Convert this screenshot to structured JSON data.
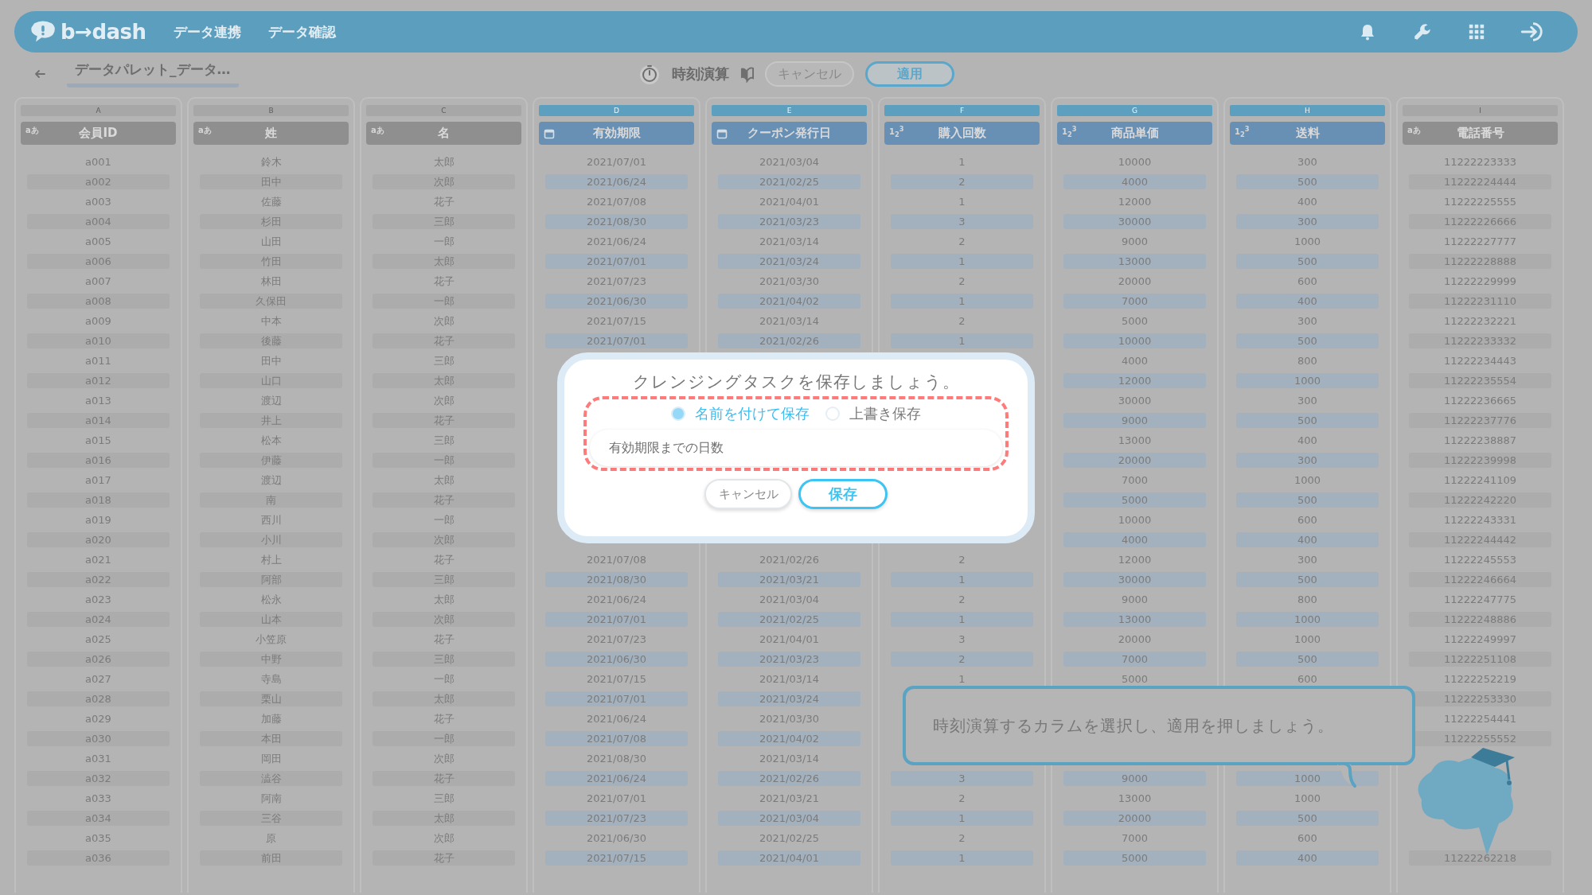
{
  "app_bar": {
    "logo": "b→dash",
    "nav": [
      {
        "label": "データ連携"
      },
      {
        "label": "データ確認"
      }
    ]
  },
  "toolbar": {
    "breadcrumb": "データパレット_データ…",
    "task_title": "時刻演算",
    "buttons": [
      {
        "label": "キャンセル",
        "kind": "secondary"
      },
      {
        "label": "適用",
        "kind": "primary"
      }
    ]
  },
  "table": {
    "columns": [
      {
        "letter": "A",
        "name": "会員ID",
        "kind": "text",
        "type_label": "aあ",
        "selected": false,
        "cells": [
          "a001",
          "a002",
          "a003",
          "a004",
          "a005",
          "a006",
          "a007",
          "a008",
          "a009",
          "a010",
          "a011",
          "a012",
          "a013",
          "a014",
          "a015",
          "a016",
          "a017",
          "a018",
          "a019",
          "a020",
          "a021",
          "a022",
          "a023",
          "a024",
          "a025",
          "a026",
          "a027",
          "a028",
          "a029",
          "a030",
          "a031",
          "a032",
          "a033",
          "a034",
          "a035",
          "a036"
        ]
      },
      {
        "letter": "B",
        "name": "姓",
        "kind": "text",
        "type_label": "aあ",
        "selected": false,
        "cells": [
          "鈴木",
          "田中",
          "佐藤",
          "杉田",
          "山田",
          "竹田",
          "林田",
          "久保田",
          "中本",
          "後藤",
          "田中",
          "山口",
          "渡辺",
          "井上",
          "松本",
          "伊藤",
          "渡辺",
          "南",
          "西川",
          "小川",
          "村上",
          "阿部",
          "松永",
          "山本",
          "小笠原",
          "中野",
          "寺島",
          "栗山",
          "加藤",
          "本田",
          "岡田",
          "澁谷",
          "阿南",
          "三谷",
          "原",
          "前田"
        ]
      },
      {
        "letter": "C",
        "name": "名",
        "kind": "text",
        "type_label": "aあ",
        "selected": false,
        "cells": [
          "太郎",
          "次郎",
          "花子",
          "三郎",
          "一郎",
          "太郎",
          "花子",
          "一郎",
          "次郎",
          "花子",
          "三郎",
          "太郎",
          "次郎",
          "花子",
          "三郎",
          "一郎",
          "太郎",
          "花子",
          "一郎",
          "次郎",
          "花子",
          "三郎",
          "太郎",
          "次郎",
          "花子",
          "三郎",
          "一郎",
          "太郎",
          "花子",
          "一郎",
          "次郎",
          "花子",
          "三郎",
          "太郎",
          "次郎",
          "花子"
        ]
      },
      {
        "letter": "D",
        "name": "有効期限",
        "kind": "date",
        "selected": true,
        "cells": [
          "2021/07/01",
          "2021/06/24",
          "2021/07/08",
          "2021/08/30",
          "2021/06/24",
          "2021/07/01",
          "2021/07/23",
          "2021/06/30",
          "2021/07/15",
          "2021/07/01",
          null,
          null,
          null,
          null,
          null,
          null,
          null,
          null,
          null,
          null,
          "2021/07/08",
          "2021/08/30",
          "2021/06/24",
          "2021/07/01",
          "2021/07/23",
          "2021/06/30",
          "2021/07/15",
          "2021/07/01",
          "2021/06/24",
          "2021/07/08",
          "2021/08/30",
          "2021/06/24",
          "2021/07/01",
          "2021/07/23",
          "2021/06/30",
          "2021/07/15"
        ]
      },
      {
        "letter": "E",
        "name": "クーポン発行日",
        "kind": "date",
        "selected": true,
        "cells": [
          "2021/03/04",
          "2021/02/25",
          "2021/04/01",
          "2021/03/23",
          "2021/03/14",
          "2021/03/24",
          "2021/03/30",
          "2021/04/02",
          "2021/03/14",
          "2021/02/26",
          null,
          null,
          null,
          null,
          null,
          null,
          null,
          null,
          null,
          null,
          "2021/02/26",
          "2021/03/21",
          "2021/03/04",
          "2021/02/25",
          "2021/04/01",
          "2021/03/23",
          "2021/03/14",
          "2021/03/24",
          "2021/03/30",
          "2021/04/02",
          "2021/03/14",
          "2021/02/26",
          "2021/03/21",
          "2021/03/04",
          "2021/02/25",
          "2021/04/01"
        ]
      },
      {
        "letter": "F",
        "name": "購入回数",
        "kind": "number",
        "type_label": "1$_{2}$$^{3}$",
        "selected": true,
        "cells": [
          "1",
          "2",
          "1",
          "3",
          "2",
          "1",
          "2",
          "1",
          "2",
          "1",
          null,
          null,
          null,
          null,
          null,
          null,
          null,
          null,
          null,
          null,
          "2",
          "1",
          "2",
          "1",
          "3",
          "2",
          "1",
          null,
          null,
          null,
          null,
          "3",
          "2",
          "1",
          "2",
          "1"
        ]
      },
      {
        "letter": "G",
        "name": "商品単価",
        "kind": "number",
        "type_label": "1$_{2}$$^{3}$",
        "selected": true,
        "cells": [
          "10000",
          "4000",
          "12000",
          "30000",
          "9000",
          "13000",
          "20000",
          "7000",
          "5000",
          "10000",
          "4000",
          "12000",
          "30000",
          "9000",
          "13000",
          "20000",
          "7000",
          "5000",
          "10000",
          "4000",
          "12000",
          "30000",
          "9000",
          "13000",
          "20000",
          "7000",
          "5000",
          null,
          null,
          null,
          null,
          "9000",
          "13000",
          "20000",
          "7000",
          "5000"
        ]
      },
      {
        "letter": "H",
        "name": "送料",
        "kind": "number",
        "type_label": "1$_{2}$$^{3}$",
        "selected": true,
        "cells": [
          "300",
          "500",
          "400",
          "300",
          "1000",
          "500",
          "600",
          "400",
          "300",
          "500",
          "800",
          "1000",
          "300",
          "500",
          "400",
          "300",
          "1000",
          "500",
          "600",
          "400",
          "300",
          "500",
          "800",
          "1000",
          "1000",
          "500",
          "600",
          null,
          null,
          null,
          null,
          "1000",
          "1000",
          "500",
          "600",
          "400"
        ]
      },
      {
        "letter": "I",
        "name": "電話番号",
        "kind": "text",
        "type_label": "aあ",
        "selected": false,
        "cells": [
          "11222223333",
          "11222224444",
          "11222225555",
          "11222226666",
          "11222227777",
          "11222228888",
          "11222229999",
          "11222231110",
          "11222232221",
          "11222233332",
          "11222234443",
          "11222235554",
          "11222236665",
          "11222237776",
          "11222238887",
          "11222239998",
          "11222241109",
          "11222242220",
          "11222243331",
          "11222244442",
          "11222245553",
          "11222246664",
          "11222247775",
          "11222248886",
          "11222249997",
          "11222251108",
          "11222252219",
          "11222253330",
          "11222254441",
          "11222255552",
          null,
          null,
          null,
          null,
          null,
          "11222262218"
        ]
      }
    ]
  },
  "dialog": {
    "title": "クレンジングタスクを保存しましょう。",
    "options": [
      {
        "label": "名前を付けて保存",
        "selected": true
      },
      {
        "label": "上書き保存",
        "selected": false
      }
    ],
    "name_field": {
      "value": "有効期限までの日数"
    },
    "buttons": [
      {
        "label": "キャンセル",
        "kind": "secondary"
      },
      {
        "label": "保存",
        "kind": "primary"
      }
    ]
  },
  "hint": {
    "text": "時刻演算するカラムを選択し、適用を押しましょう。"
  }
}
